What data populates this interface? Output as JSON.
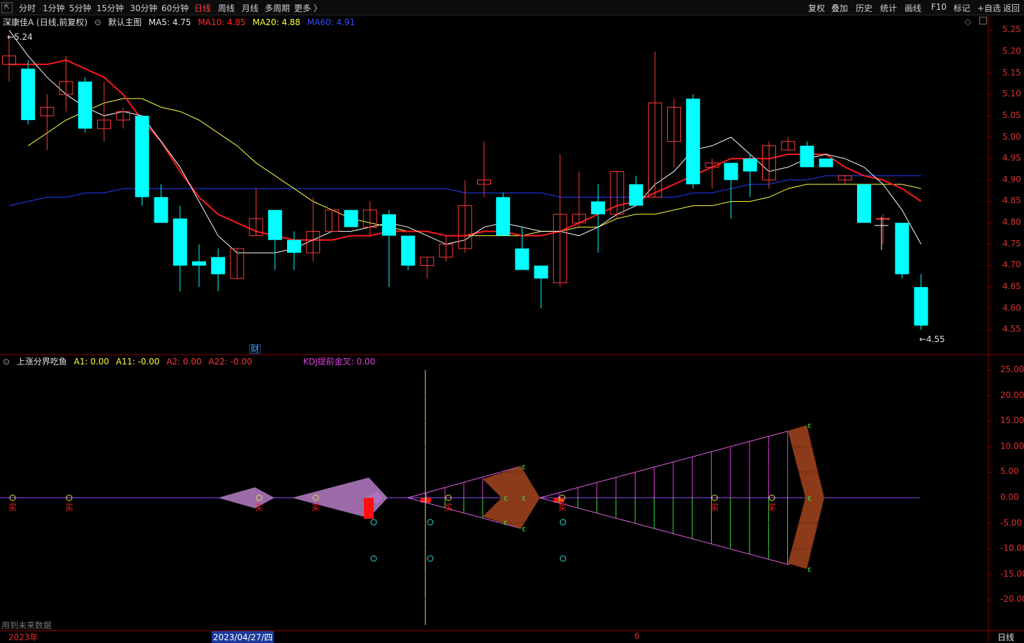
{
  "toolbar": {
    "left_icon": "back-icon",
    "periods": [
      "分时",
      "1分钟",
      "5分钟",
      "15分钟",
      "30分钟",
      "60分钟",
      "日线",
      "周线",
      "月线",
      "多周期",
      "更多 〉"
    ],
    "active_period": "日线",
    "right_buttons": [
      "复权",
      "叠加",
      "历史",
      "统计",
      "画线",
      "F10",
      "标记",
      "+自选",
      "返回"
    ]
  },
  "main_legend": {
    "stock": "深康佳A (日线,前复权)",
    "template": "默认主图",
    "ma5": "MA5: 4.75",
    "ma10": "MA10: 4.85",
    "ma20": "MA20: 4.88",
    "ma60": "MA60: 4.91",
    "colors": {
      "ma5": "#ffffff",
      "ma10": "#ff2020",
      "ma20": "#ffff40",
      "ma60": "#2040ff"
    }
  },
  "main_annotations": {
    "high": "5.24",
    "low": "4.55",
    "finance_marker": "财"
  },
  "sub_legend": {
    "name": "上涨分界吃鱼",
    "a1": "A1: 0.00",
    "a11": "A11: -0.00",
    "a2": "A2: 0.00",
    "a22": "A22: -0.00",
    "kdj": "KDJ提前金叉: 0.00"
  },
  "price_axis": [
    "5.25",
    "5.20",
    "5.15",
    "5.10",
    "5.05",
    "5.00",
    "4.95",
    "4.90",
    "4.85",
    "4.80",
    "4.75",
    "4.70",
    "4.65",
    "4.60",
    "4.55"
  ],
  "sub_axis": [
    "25.00",
    "20.00",
    "15.00",
    "10.00",
    "5.00",
    "0.00",
    "-5.00",
    "-10.00",
    "-15.00",
    "-20.00"
  ],
  "x_axis": {
    "year": "2023年",
    "cursor_date": "2023/04/27/四",
    "month_mark": "6",
    "period_label": "日线"
  },
  "footer_note": "用到未来数据",
  "signal_labels": {
    "buy": "买"
  },
  "chart_data": {
    "type": "candlestick",
    "candles": [
      {
        "o": 5.17,
        "h": 5.24,
        "l": 5.13,
        "c": 5.19
      },
      {
        "o": 5.16,
        "h": 5.18,
        "l": 5.03,
        "c": 5.04
      },
      {
        "o": 5.05,
        "h": 5.1,
        "l": 4.97,
        "c": 5.07
      },
      {
        "o": 5.1,
        "h": 5.19,
        "l": 5.06,
        "c": 5.13
      },
      {
        "o": 5.13,
        "h": 5.14,
        "l": 5.01,
        "c": 5.02
      },
      {
        "o": 5.02,
        "h": 5.13,
        "l": 4.99,
        "c": 5.04
      },
      {
        "o": 5.04,
        "h": 5.07,
        "l": 5.02,
        "c": 5.06
      },
      {
        "o": 5.05,
        "h": 5.05,
        "l": 4.84,
        "c": 4.86
      },
      {
        "o": 4.86,
        "h": 4.89,
        "l": 4.8,
        "c": 4.8
      },
      {
        "o": 4.81,
        "h": 4.84,
        "l": 4.64,
        "c": 4.7
      },
      {
        "o": 4.71,
        "h": 4.75,
        "l": 4.65,
        "c": 4.7
      },
      {
        "o": 4.72,
        "h": 4.74,
        "l": 4.64,
        "c": 4.68
      },
      {
        "o": 4.67,
        "h": 4.74,
        "l": 4.67,
        "c": 4.74
      },
      {
        "o": 4.77,
        "h": 4.88,
        "l": 4.77,
        "c": 4.81
      },
      {
        "o": 4.83,
        "h": 4.83,
        "l": 4.69,
        "c": 4.76
      },
      {
        "o": 4.76,
        "h": 4.78,
        "l": 4.69,
        "c": 4.73
      },
      {
        "o": 4.73,
        "h": 4.86,
        "l": 4.71,
        "c": 4.78
      },
      {
        "o": 4.78,
        "h": 4.83,
        "l": 4.78,
        "c": 4.83
      },
      {
        "o": 4.83,
        "h": 4.83,
        "l": 4.79,
        "c": 4.79
      },
      {
        "o": 4.79,
        "h": 4.85,
        "l": 4.77,
        "c": 4.83
      },
      {
        "o": 4.82,
        "h": 4.83,
        "l": 4.65,
        "c": 4.77
      },
      {
        "o": 4.77,
        "h": 4.77,
        "l": 4.69,
        "c": 4.7
      },
      {
        "o": 4.7,
        "h": 4.72,
        "l": 4.67,
        "c": 4.72
      },
      {
        "o": 4.72,
        "h": 4.77,
        "l": 4.71,
        "c": 4.75
      },
      {
        "o": 4.74,
        "h": 4.9,
        "l": 4.73,
        "c": 4.84
      },
      {
        "o": 4.89,
        "h": 4.99,
        "l": 4.86,
        "c": 4.9
      },
      {
        "o": 4.86,
        "h": 4.87,
        "l": 4.77,
        "c": 4.77
      },
      {
        "o": 4.74,
        "h": 4.79,
        "l": 4.69,
        "c": 4.69
      },
      {
        "o": 4.7,
        "h": 4.7,
        "l": 4.6,
        "c": 4.67
      },
      {
        "o": 4.66,
        "h": 4.96,
        "l": 4.65,
        "c": 4.82
      },
      {
        "o": 4.8,
        "h": 4.92,
        "l": 4.79,
        "c": 4.82
      },
      {
        "o": 4.85,
        "h": 4.89,
        "l": 4.73,
        "c": 4.82
      },
      {
        "o": 4.82,
        "h": 4.92,
        "l": 4.81,
        "c": 4.92
      },
      {
        "o": 4.89,
        "h": 4.91,
        "l": 4.84,
        "c": 4.84
      },
      {
        "o": 4.86,
        "h": 5.2,
        "l": 4.86,
        "c": 5.08
      },
      {
        "o": 4.99,
        "h": 5.09,
        "l": 4.93,
        "c": 5.07
      },
      {
        "o": 5.09,
        "h": 5.1,
        "l": 4.88,
        "c": 4.89
      },
      {
        "o": 4.93,
        "h": 4.95,
        "l": 4.88,
        "c": 4.94
      },
      {
        "o": 4.94,
        "h": 4.94,
        "l": 4.81,
        "c": 4.9
      },
      {
        "o": 4.95,
        "h": 4.96,
        "l": 4.86,
        "c": 4.92
      },
      {
        "o": 4.9,
        "h": 4.99,
        "l": 4.88,
        "c": 4.98
      },
      {
        "o": 4.97,
        "h": 5.0,
        "l": 4.97,
        "c": 4.99
      },
      {
        "o": 4.98,
        "h": 4.99,
        "l": 4.93,
        "c": 4.93
      },
      {
        "o": 4.95,
        "h": 4.95,
        "l": 4.93,
        "c": 4.93
      },
      {
        "o": 4.9,
        "h": 4.91,
        "l": 4.89,
        "c": 4.91
      },
      {
        "o": 4.89,
        "h": 4.89,
        "l": 4.8,
        "c": 4.8
      },
      {
        "o": 4.81,
        "h": 4.82,
        "l": 4.75,
        "c": 4.81
      },
      {
        "o": 4.8,
        "h": 4.8,
        "l": 4.67,
        "c": 4.68
      },
      {
        "o": 4.65,
        "h": 4.68,
        "l": 4.55,
        "c": 4.56
      }
    ],
    "ma5": [
      5.25,
      5.19,
      5.14,
      5.1,
      5.07,
      5.05,
      5.06,
      5.05,
      4.99,
      4.93,
      4.85,
      4.77,
      4.73,
      4.73,
      4.73,
      4.74,
      4.76,
      4.78,
      4.78,
      4.79,
      4.8,
      4.79,
      4.77,
      4.75,
      4.76,
      4.79,
      4.8,
      4.79,
      4.78,
      4.78,
      4.77,
      4.79,
      4.82,
      4.84,
      4.89,
      4.92,
      4.97,
      4.98,
      5.0,
      4.96,
      4.92,
      4.93,
      4.95,
      4.96,
      4.95,
      4.93,
      4.89,
      4.83,
      4.75
    ],
    "ma10": [
      5.17,
      5.17,
      5.17,
      5.18,
      5.16,
      5.14,
      5.1,
      5.04,
      4.99,
      4.92,
      4.86,
      4.82,
      4.8,
      4.78,
      4.77,
      4.76,
      4.76,
      4.76,
      4.77,
      4.77,
      4.78,
      4.78,
      4.78,
      4.77,
      4.77,
      4.78,
      4.78,
      4.77,
      4.77,
      4.78,
      4.8,
      4.82,
      4.84,
      4.85,
      4.87,
      4.89,
      4.91,
      4.93,
      4.95,
      4.95,
      4.95,
      4.96,
      4.96,
      4.96,
      4.93,
      4.91,
      4.9,
      4.88,
      4.85
    ],
    "ma20": [
      4.98,
      5.01,
      5.04,
      5.06,
      5.08,
      5.09,
      5.09,
      5.07,
      5.06,
      5.04,
      5.01,
      4.98,
      4.94,
      4.91,
      4.88,
      4.85,
      4.83,
      4.81,
      4.8,
      4.79,
      4.78,
      4.78,
      4.77,
      4.77,
      4.77,
      4.77,
      4.77,
      4.78,
      4.78,
      4.79,
      4.79,
      4.81,
      4.82,
      4.82,
      4.83,
      4.84,
      4.84,
      4.85,
      4.85,
      4.86,
      4.88,
      4.89,
      4.89,
      4.89,
      4.89,
      4.89,
      4.89,
      4.88
    ],
    "ma60": [
      4.84,
      4.85,
      4.86,
      4.86,
      4.87,
      4.87,
      4.88,
      4.88,
      4.88,
      4.88,
      4.88,
      4.88,
      4.88,
      4.88,
      4.88,
      4.88,
      4.88,
      4.88,
      4.88,
      4.88,
      4.88,
      4.88,
      4.88,
      4.88,
      4.87,
      4.87,
      4.87,
      4.87,
      4.87,
      4.86,
      4.86,
      4.86,
      4.86,
      4.86,
      4.86,
      4.86,
      4.87,
      4.87,
      4.88,
      4.89,
      4.89,
      4.9,
      4.9,
      4.91,
      4.91,
      4.91,
      4.91,
      4.91,
      4.91
    ],
    "y_range": [
      4.51,
      5.265
    ],
    "sub_y_range": [
      -25,
      27.5
    ]
  }
}
